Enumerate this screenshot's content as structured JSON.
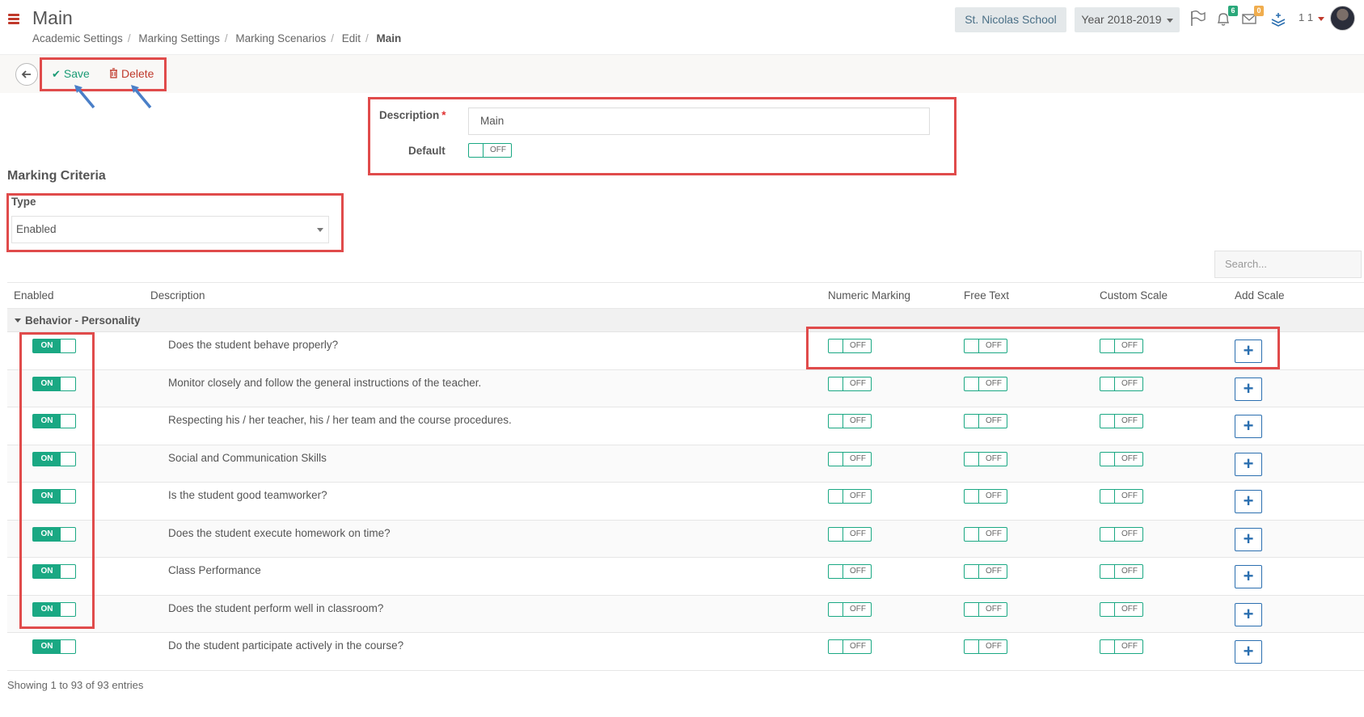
{
  "header": {
    "title": "Main",
    "breadcrumb": [
      "Academic Settings",
      "Marking Settings",
      "Marking Scenarios",
      "Edit",
      "Main"
    ],
    "school": "St. Nicolas School",
    "year": "Year 2018-2019",
    "notifications_count": "6",
    "messages_count": "0",
    "user_number": "1 1"
  },
  "toolbar": {
    "save_label": "Save",
    "delete_label": "Delete"
  },
  "form": {
    "description_label": "Description",
    "description_value": "Main",
    "default_label": "Default",
    "default_state": "OFF"
  },
  "criteria": {
    "section_title": "Marking Criteria",
    "type_label": "Type",
    "type_value": "Enabled",
    "search_placeholder": "Search..."
  },
  "table": {
    "columns": [
      "Enabled",
      "Description",
      "Numeric Marking",
      "Free Text",
      "Custom Scale",
      "Add Scale"
    ],
    "group": "Behavior - Personality",
    "rows": [
      {
        "enabled": "ON",
        "description": "Does the student behave properly?",
        "numeric": "OFF",
        "free_text": "OFF",
        "custom_scale": "OFF"
      },
      {
        "enabled": "ON",
        "description": "Monitor closely and follow the general instructions of the teacher.",
        "numeric": "OFF",
        "free_text": "OFF",
        "custom_scale": "OFF"
      },
      {
        "enabled": "ON",
        "description": "Respecting his / her teacher, his / her team and the course procedures.",
        "numeric": "OFF",
        "free_text": "OFF",
        "custom_scale": "OFF"
      },
      {
        "enabled": "ON",
        "description": "Social and Communication Skills",
        "numeric": "OFF",
        "free_text": "OFF",
        "custom_scale": "OFF"
      },
      {
        "enabled": "ON",
        "description": "Is the student good teamworker?",
        "numeric": "OFF",
        "free_text": "OFF",
        "custom_scale": "OFF"
      },
      {
        "enabled": "ON",
        "description": "Does the student execute homework on time?",
        "numeric": "OFF",
        "free_text": "OFF",
        "custom_scale": "OFF"
      },
      {
        "enabled": "ON",
        "description": "Class Performance",
        "numeric": "OFF",
        "free_text": "OFF",
        "custom_scale": "OFF"
      },
      {
        "enabled": "ON",
        "description": "Does the student perform well in classroom?",
        "numeric": "OFF",
        "free_text": "OFF",
        "custom_scale": "OFF"
      },
      {
        "enabled": "ON",
        "description": "Do the student participate actively in the course?",
        "numeric": "OFF",
        "free_text": "OFF",
        "custom_scale": "OFF"
      }
    ],
    "add_symbol": "+",
    "footer": "Showing 1 to 93 of 93 entries"
  },
  "colors": {
    "accent_green": "#1aa883",
    "danger_red": "#c0392b",
    "highlight_red": "#e04b4b",
    "button_blue": "#2b6fb0"
  },
  "icons": [
    "hamburger-icon",
    "flag-icon",
    "bell-icon",
    "envelope-icon",
    "layers-icon",
    "back-arrow-icon",
    "check-icon",
    "trash-icon",
    "caret-down-icon",
    "plus-icon"
  ]
}
